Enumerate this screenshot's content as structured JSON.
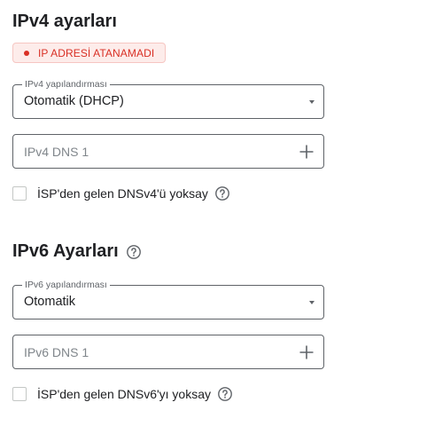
{
  "ipv4": {
    "title": "IPv4 ayarları",
    "status": "IP ADRESİ ATANAMADI",
    "config_label": "IPv4 yapılandırması",
    "config_value": "Otomatik (DHCP)",
    "dns_placeholder": "IPv4 DNS 1",
    "ignore_isp_label": "İSP'den gelen DNSv4'ü yoksay",
    "ignore_isp_checked": false
  },
  "ipv6": {
    "title": "IPv6 Ayarları",
    "config_label": "IPv6 yapılandırması",
    "config_value": "Otomatik",
    "dns_placeholder": "IPv6 DNS 1",
    "ignore_isp_label": "İSP'den gelen DNSv6'yı yoksay",
    "ignore_isp_checked": false
  },
  "colors": {
    "error": "#d93025",
    "error_bg": "#fdecea",
    "border": "#5f6368",
    "text": "#202124"
  },
  "icons": {
    "help": "help-circle-icon",
    "add": "plus-icon",
    "dropdown": "caret-down-icon",
    "status": "dot-icon"
  }
}
